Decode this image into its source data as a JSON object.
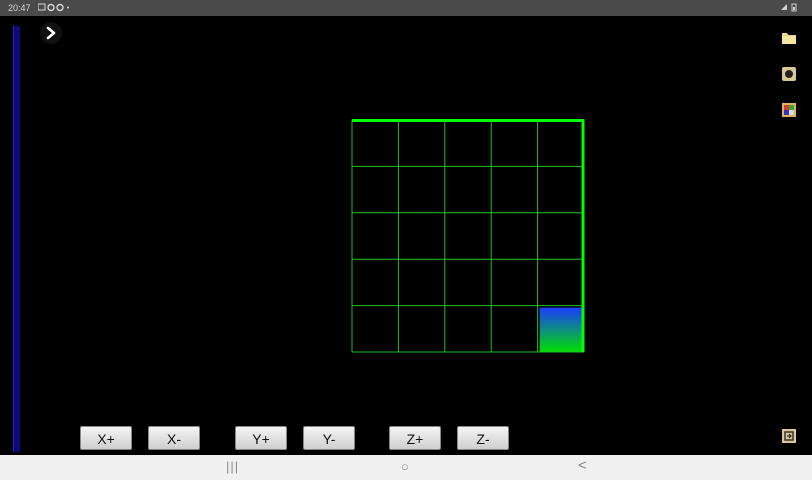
{
  "status_bar": {
    "time": "20:47",
    "icons": [
      "screen-icon",
      "settings-icon",
      "settings-icon",
      "dot"
    ],
    "right_icons": [
      "wifi-icon",
      "battery-icon"
    ]
  },
  "controls": {
    "x_plus": "X+",
    "x_minus": "X-",
    "y_plus": "Y+",
    "y_minus": "Y-",
    "z_plus": "Z+",
    "z_minus": "Z-"
  },
  "grid": {
    "rows": 5,
    "cols": 5,
    "line_color": "#22c022",
    "edge_color": "#00ff00",
    "highlight_cell": {
      "row": 4,
      "col": 4
    },
    "highlight_gradient": [
      "#1a3cff",
      "#00e000"
    ]
  },
  "colors": {
    "background": "#000000",
    "rail": "#0a0a7a",
    "nav_bar": "#f0f0f0"
  },
  "nav": {
    "recents": "|||",
    "home": "○",
    "back": "<"
  },
  "side_icons": [
    "folder-icon",
    "record-icon",
    "palette-icon",
    "exit-icon"
  ]
}
